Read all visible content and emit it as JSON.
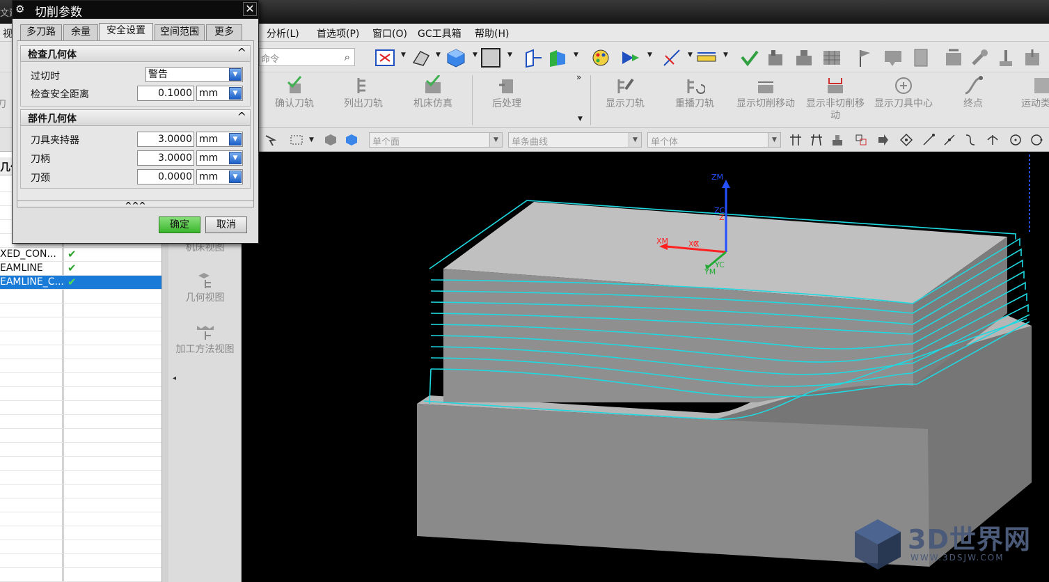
{
  "window": {
    "title_fragment": "文建"
  },
  "menubar": {
    "left_fragment": "视",
    "items": [
      "分析(L)",
      "首选项(P)",
      "窗口(O)",
      "GC工具箱",
      "帮助(H)"
    ]
  },
  "toolbar": {
    "command_search_placeholder": "命令"
  },
  "ribbon": {
    "left_fragment": "刀",
    "buttons": [
      "确认刀轨",
      "列出刀轨",
      "机床仿真",
      "后处理",
      "显示刀轨",
      "重播刀轨",
      "显示切削移动",
      "显示非切削移动",
      "显示刀具中心",
      "终点",
      "运动类"
    ]
  },
  "selection_bar": {
    "face_filter": "单个面",
    "curve_filter": "单条曲线",
    "body_filter": "单个体"
  },
  "navigator": {
    "header_fragment": "几位",
    "rows": [
      {
        "name": "XED_CON...",
        "checked": true,
        "selected": false
      },
      {
        "name": "EAMLINE",
        "checked": true,
        "selected": false
      },
      {
        "name": "EAMLINE_C...",
        "checked": true,
        "selected": true
      }
    ],
    "check_mark": "✔"
  },
  "resource_panel": {
    "items": [
      "机床视图",
      "几何视图",
      "加工方法视图"
    ],
    "arrow": "◂"
  },
  "dialog": {
    "title": "切削参数",
    "close": "✕",
    "tabs": [
      "多刀路",
      "余量",
      "安全设置",
      "空间范围",
      "更多"
    ],
    "active_tab": "安全设置",
    "check_geometry": {
      "title": "检查几何体",
      "overcut_label": "过切时",
      "overcut_value": "警告",
      "safe_dist_label": "检查安全距离",
      "safe_dist_value": "0.1000",
      "safe_dist_unit": "mm"
    },
    "part_geometry": {
      "title": "部件几何体",
      "holder_label": "刀具夹持器",
      "holder_value": "3.0000",
      "shank_label": "刀柄",
      "shank_value": "3.0000",
      "neck_label": "刀颈",
      "neck_value": "0.0000",
      "unit": "mm"
    },
    "collapse_icon": "^",
    "expand_more": "^^^",
    "ok_label": "确定",
    "cancel_label": "取消"
  },
  "viewport": {
    "axes": {
      "zm": "ZM",
      "zc": "ZC",
      "z": "Z",
      "xm": "XM",
      "xc": "XC",
      "x": "X",
      "yc": "YC",
      "ym": "YM"
    },
    "colors": {
      "toolpath": "#1fd8e0",
      "part_top": "#bdbdbd",
      "part_front": "#8e8e8e",
      "part_side": "#7a7a7a",
      "axis_z": "#2450ff",
      "axis_x": "#ff2020",
      "axis_y": "#22aa33"
    }
  },
  "watermark": {
    "title": "3D世界网",
    "url": "WWW.3DSJW.COM"
  }
}
